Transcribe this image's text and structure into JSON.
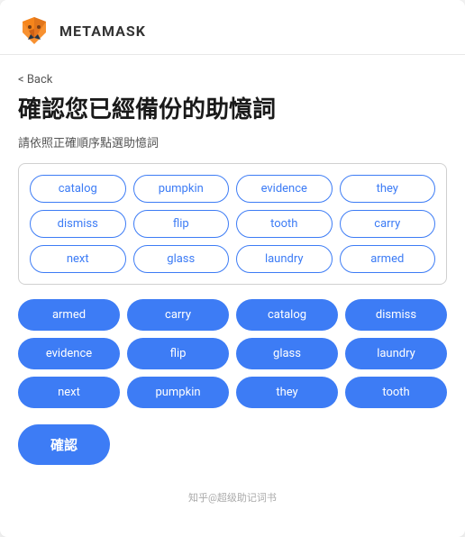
{
  "header": {
    "logo_text": "METAMASK"
  },
  "back": {
    "label": "< Back"
  },
  "page": {
    "title": "確認您已經備份的助憶詞",
    "subtitle": "請依照正確順序點選助憶詞"
  },
  "word_pool": {
    "words": [
      "catalog",
      "pumpkin",
      "evidence",
      "they",
      "dismiss",
      "flip",
      "tooth",
      "carry",
      "next",
      "glass",
      "laundry",
      "armed"
    ]
  },
  "selected_words": {
    "words": [
      "armed",
      "carry",
      "catalog",
      "dismiss",
      "evidence",
      "flip",
      "glass",
      "laundry",
      "next",
      "pumpkin",
      "they",
      "tooth"
    ]
  },
  "confirm_button": {
    "label": "確認"
  },
  "watermark": {
    "text": "知乎@超级助记词书"
  }
}
